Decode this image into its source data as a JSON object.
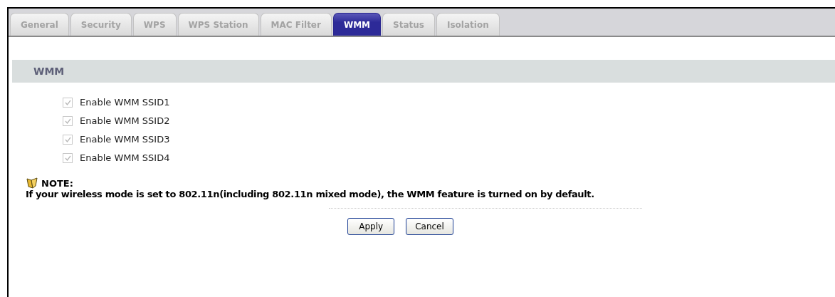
{
  "tabs": [
    {
      "label": "General",
      "selected": false
    },
    {
      "label": "Security",
      "selected": false
    },
    {
      "label": "WPS",
      "selected": false
    },
    {
      "label": "WPS Station",
      "selected": false
    },
    {
      "label": "MAC Filter",
      "selected": false
    },
    {
      "label": "WMM",
      "selected": true
    },
    {
      "label": "Status",
      "selected": false
    },
    {
      "label": "Isolation",
      "selected": false
    }
  ],
  "section": {
    "title": "WMM"
  },
  "options": [
    {
      "label": "Enable WMM SSID1",
      "checked": true,
      "disabled": true
    },
    {
      "label": "Enable WMM SSID2",
      "checked": true,
      "disabled": true
    },
    {
      "label": "Enable WMM SSID3",
      "checked": true,
      "disabled": true
    },
    {
      "label": "Enable WMM SSID4",
      "checked": true,
      "disabled": true
    }
  ],
  "note": {
    "title": "NOTE:",
    "text": "If your wireless mode is set to 802.11n(including 802.11n mixed mode), the WMM feature is turned on by default."
  },
  "buttons": [
    "Apply",
    "Cancel"
  ]
}
